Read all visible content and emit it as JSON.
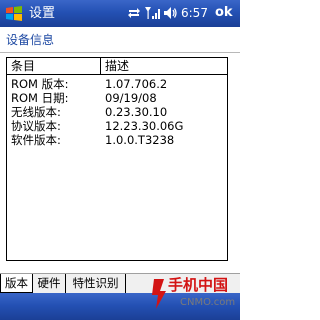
{
  "titlebar": {
    "title": "设置",
    "time": "6:57",
    "ok_label": "ok",
    "start_icon": "windows-start-icon",
    "status_icons": [
      "connectivity-icon",
      "signal-icon",
      "volume-icon"
    ]
  },
  "page": {
    "header": "设备信息"
  },
  "table": {
    "columns": [
      "条目",
      "描述"
    ],
    "rows": [
      {
        "key": "ROM 版本:",
        "value": "1.07.706.2"
      },
      {
        "key": "ROM 日期:",
        "value": "09/19/08"
      },
      {
        "key": "无线版本:",
        "value": "0.23.30.10"
      },
      {
        "key": "协议版本:",
        "value": "12.23.30.06G"
      },
      {
        "key": "软件版本:",
        "value": "1.0.0.T3238"
      }
    ]
  },
  "tabs": [
    {
      "label": "版本",
      "selected": true
    },
    {
      "label": "硬件",
      "selected": false
    },
    {
      "label": "特性识别",
      "selected": false
    }
  ],
  "watermark": {
    "cn": "手机中国",
    "en": "CNMO.com"
  },
  "colors": {
    "titlebar": "#2451b4",
    "header_text": "#1f4aa3",
    "watermark_red": "#d31414"
  }
}
